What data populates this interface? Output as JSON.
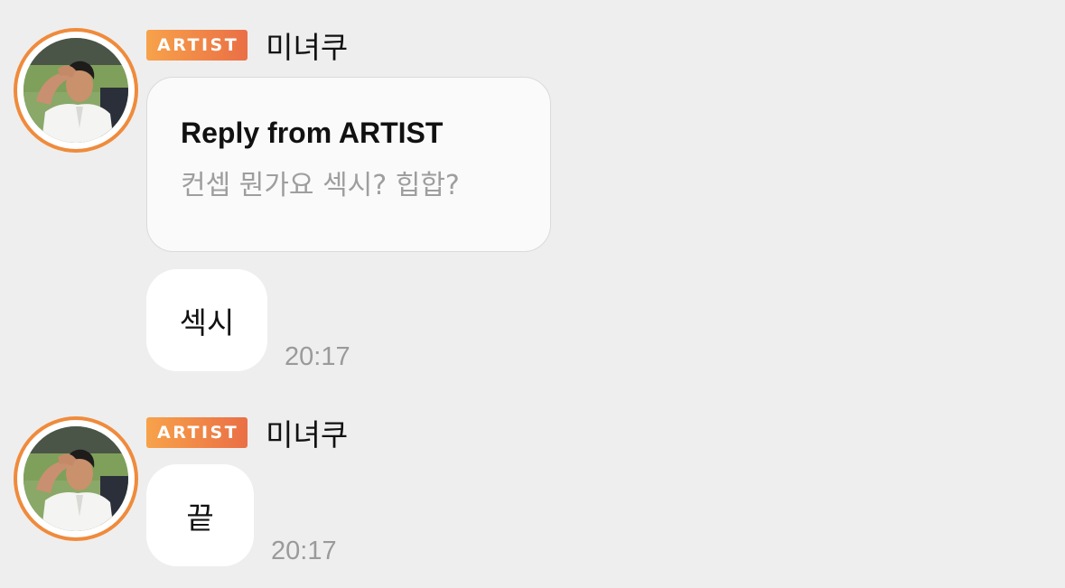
{
  "messages": [
    {
      "badge": "ARTIST",
      "sender": "미녀쿠",
      "reply": {
        "title": "Reply from ARTIST",
        "quote": "컨셉 뭔가요 섹시? 힙합?"
      },
      "text": "섹시",
      "time": "20:17"
    },
    {
      "badge": "ARTIST",
      "sender": "미녀쿠",
      "text": "끝",
      "time": "20:17"
    }
  ],
  "colors": {
    "background": "#eeeeee",
    "badge_gradient_start": "#f7a24a",
    "badge_gradient_end": "#ea6f45",
    "avatar_ring": "#ef8b3c",
    "bubble": "#ffffff",
    "reply_card": "#fafafa",
    "muted_text": "#9e9e9e"
  },
  "icons": {
    "avatar": "artist-profile-photo"
  }
}
